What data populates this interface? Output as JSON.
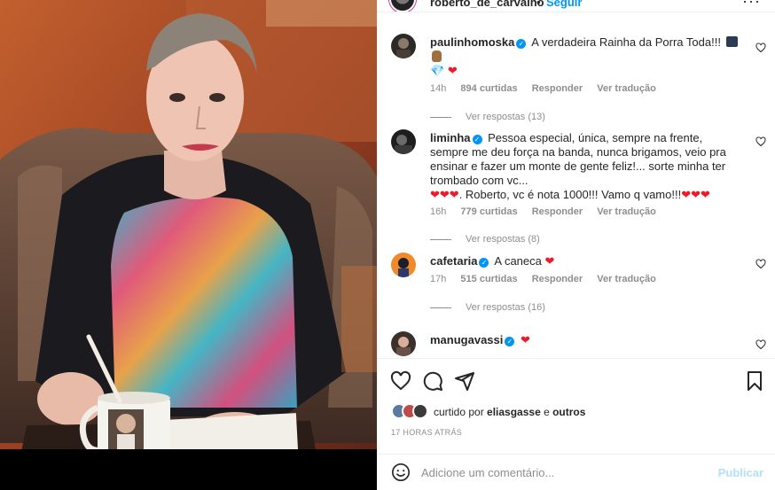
{
  "header": {
    "username": "roberto_de_carvalho",
    "separator": "•",
    "follow_label": "Seguir",
    "more_label": "···"
  },
  "comments": [
    {
      "username": "paulinhomoska",
      "text": "A verdadeira Rainha da Porra Toda!!!",
      "emojis_line2": "💎",
      "time": "14h",
      "likes": "894 curtidas",
      "reply_label": "Responder",
      "translate_label": "Ver tradução",
      "replies_label": "Ver respostas (13)"
    },
    {
      "username": "liminha",
      "text": "Pessoa especial, única, sempre na frente, sempre me deu força na banda, nunca brigamos, veio pra ensinar e fazer um monte de gente feliz!... sorte minha ter trombado com vc...",
      "text_tail": ". Roberto, vc é nota 1000!!! Vamo q vamo!!!",
      "time": "16h",
      "likes": "779 curtidas",
      "reply_label": "Responder",
      "translate_label": "Ver tradução",
      "replies_label": "Ver respostas (8)"
    },
    {
      "username": "cafetaria",
      "text": "A caneca",
      "time": "17h",
      "likes": "515 curtidas",
      "reply_label": "Responder",
      "translate_label": "Ver tradução",
      "replies_label": "Ver respostas (16)"
    },
    {
      "username": "manugavassi",
      "text": ""
    }
  ],
  "likes": {
    "prefix": "curtido por ",
    "user": "eliasgasse",
    "suffix": " e ",
    "others": "outros"
  },
  "time_ago": "17 HORAS ATRÁS",
  "add_comment": {
    "placeholder": "Adicione um comentário...",
    "publish_label": "Publicar"
  },
  "colors": {
    "accent": "#0095f6",
    "heart": "#ed1a2a",
    "muted": "#8e8e8e",
    "publish_disabled": "#b2dffc"
  },
  "icons": {
    "like": "heart-outline-icon",
    "comment": "speech-bubble-icon",
    "share": "paper-plane-icon",
    "save": "bookmark-icon",
    "emoji": "smiley-icon"
  }
}
